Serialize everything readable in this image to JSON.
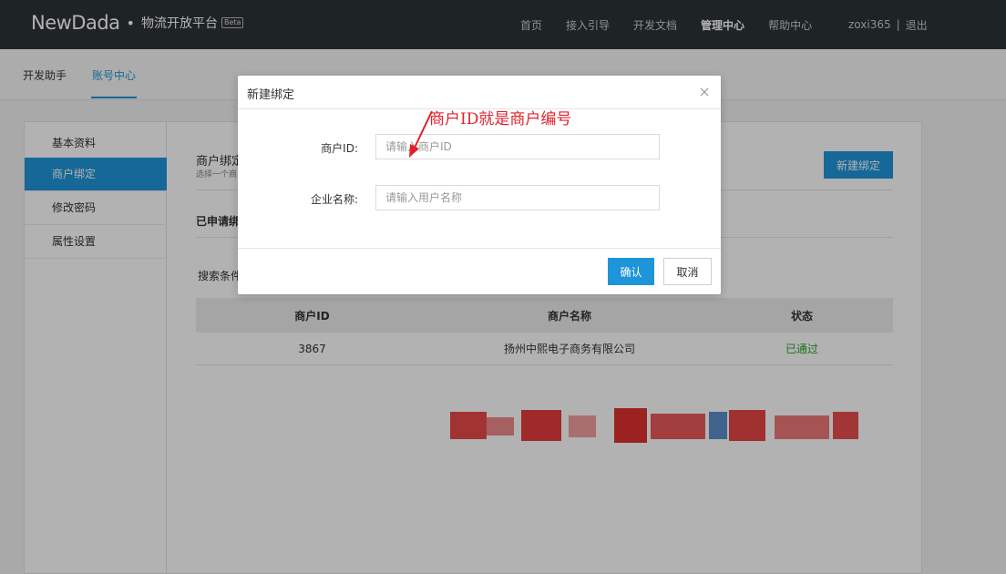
{
  "nav": {
    "brand": "NewDada",
    "dot": "•",
    "subtitle": "物流开放平台",
    "beta": "Beta",
    "links": [
      {
        "label": "首页",
        "active": false
      },
      {
        "label": "接入引导",
        "active": false
      },
      {
        "label": "开发文档",
        "active": false
      },
      {
        "label": "管理中心",
        "active": true
      },
      {
        "label": "帮助中心",
        "active": false
      }
    ],
    "username": "zoxi365",
    "separator": "|",
    "logout": "退出"
  },
  "subnav": {
    "tabs": [
      "开发助手",
      "账号中心"
    ]
  },
  "sidebar": {
    "items": [
      {
        "label": "基本资料",
        "active": false
      },
      {
        "label": "商户绑定",
        "active": true
      },
      {
        "label": "修改密码",
        "active": false
      },
      {
        "label": "属性设置",
        "active": false
      }
    ]
  },
  "content": {
    "bind_title": "商户绑定",
    "bind_desc": "选择一个商",
    "new_bind_button": "新建绑定",
    "applied_title": "已申请绑",
    "search_label": "搜索条件",
    "table": {
      "headers": [
        "商户ID",
        "商户名称",
        "状态"
      ],
      "rows": [
        {
          "id": "3867",
          "name": "扬州中熙电子商务有限公司",
          "status": "已通过"
        }
      ]
    }
  },
  "modal": {
    "title": "新建绑定",
    "fields": [
      {
        "label": "商户ID:",
        "placeholder": "请输入商户ID",
        "value": ""
      },
      {
        "label": "企业名称:",
        "placeholder": "请输入用户名称",
        "value": ""
      }
    ],
    "confirm": "确认",
    "cancel": "取消"
  },
  "annotation": {
    "text": "商户ID就是商户编号",
    "color": "#e0222c"
  },
  "colors": {
    "accent": "#1f95d9",
    "nav_bg": "#2c3336",
    "success": "#29a329"
  }
}
